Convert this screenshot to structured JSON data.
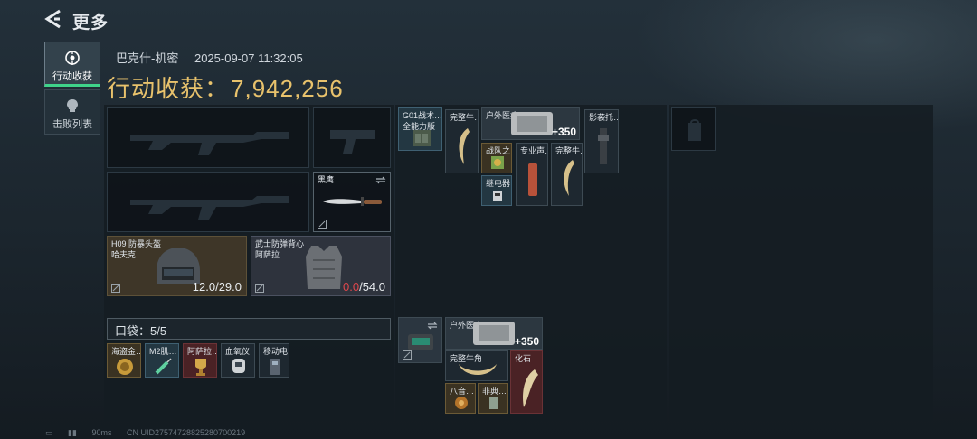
{
  "header": {
    "title": "更多"
  },
  "nav": [
    {
      "label": "行动收获",
      "icon": "target-icon"
    },
    {
      "label": "击败列表",
      "icon": "skull-icon"
    }
  ],
  "meta": {
    "map": "巴克什-机密",
    "datetime": "2025-09-07 11:32:05"
  },
  "earnings": {
    "label": "行动收获：",
    "value": "7,942,256"
  },
  "gear": {
    "secondary_name": "黑鹰",
    "helmet_name_1": "H09 防暴头盔",
    "helmet_name_2": "哈夫克",
    "helmet_durability": "12.0/29.0",
    "armor_name_1": "武士防弹背心",
    "armor_name_2": "阿萨拉",
    "armor_durability_current": "0.0",
    "armor_durability_max": "/54.0"
  },
  "pockets": {
    "label": "口袋：",
    "count": "5/5",
    "items": [
      "海盗金…",
      "M2肌…",
      "阿萨拉…",
      "血氧仪",
      "移动电…"
    ]
  },
  "chest_rig": {
    "items": [
      {
        "name": "G01战术…",
        "name2": "全能力版"
      },
      {
        "name": "完整牛…"
      },
      {
        "name": "户外医疗…",
        "qty": "+350"
      },
      {
        "name": "影袭托…"
      },
      {
        "name": "战队之…"
      },
      {
        "name": "专业声…"
      },
      {
        "name": "完整牛…"
      },
      {
        "name": "继电器"
      }
    ]
  },
  "backpack": {
    "items": [
      {
        "name": "户外医疗…",
        "qty": "+350"
      },
      {
        "name": "完整牛角"
      },
      {
        "name": "化石"
      },
      {
        "name": "八音…"
      },
      {
        "name": "非典…"
      }
    ]
  },
  "footer": {
    "ping": "90ms",
    "uid": "CN UID2757472882528070021​9"
  },
  "colors": {
    "gold": "#e8c26c",
    "accent_green": "#3fd38a",
    "danger": "#e0474c"
  }
}
